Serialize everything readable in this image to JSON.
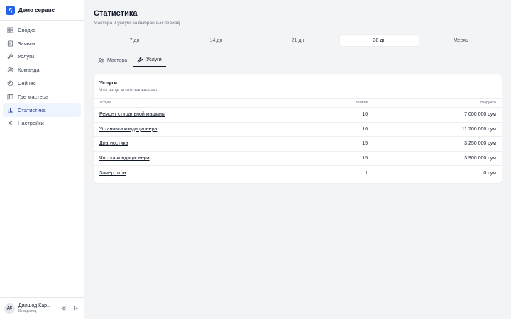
{
  "brand": {
    "logo": "Д",
    "name": "Демо сервис"
  },
  "sidebar": {
    "items": [
      {
        "label": "Сводка",
        "icon": "dashboard-icon"
      },
      {
        "label": "Заявки",
        "icon": "orders-icon"
      },
      {
        "label": "Услуги",
        "icon": "wrench-icon"
      },
      {
        "label": "Команда",
        "icon": "team-icon"
      },
      {
        "label": "Сейчас",
        "icon": "location-icon"
      },
      {
        "label": "Где мастера",
        "icon": "map-icon"
      },
      {
        "label": "Статистика",
        "icon": "bar-chart-icon",
        "active": true
      },
      {
        "label": "Настройки",
        "icon": "gear-icon"
      }
    ]
  },
  "user": {
    "initials": "ДК",
    "name": "Дилшод Кар...",
    "role": "Владелец"
  },
  "page": {
    "title": "Статистика",
    "subtitle": "Мастера и услуги за выбранный период"
  },
  "periods": [
    "7 дн",
    "14 дн",
    "21 дн",
    "30 дн",
    "Месяц"
  ],
  "active_period": "30 дн",
  "tabs": [
    {
      "label": "Мастера",
      "icon": "users-icon"
    },
    {
      "label": "Услуги",
      "icon": "wrench-icon",
      "active": true
    }
  ],
  "card": {
    "title": "Услуги",
    "subtitle": "Что чаще всего заказывают",
    "columns": [
      "Услуга",
      "Заявок",
      "Выручка"
    ],
    "rows": [
      {
        "service": "Ремонт стиральной машины",
        "orders": "16",
        "revenue": "7 000 000 сум"
      },
      {
        "service": "Установка кондиционера",
        "orders": "16",
        "revenue": "11 700 000 сум"
      },
      {
        "service": "Диагностика",
        "orders": "15",
        "revenue": "3 250 000 сум"
      },
      {
        "service": "Чистка кондиционера",
        "orders": "15",
        "revenue": "3 900 000 сум"
      },
      {
        "service": "Замер окон",
        "orders": "1",
        "revenue": "0 сум"
      }
    ]
  },
  "colors": {
    "accent": "#2563eb",
    "active_nav_bg": "#eff5ff",
    "page_bg": "#f3f4f6"
  }
}
